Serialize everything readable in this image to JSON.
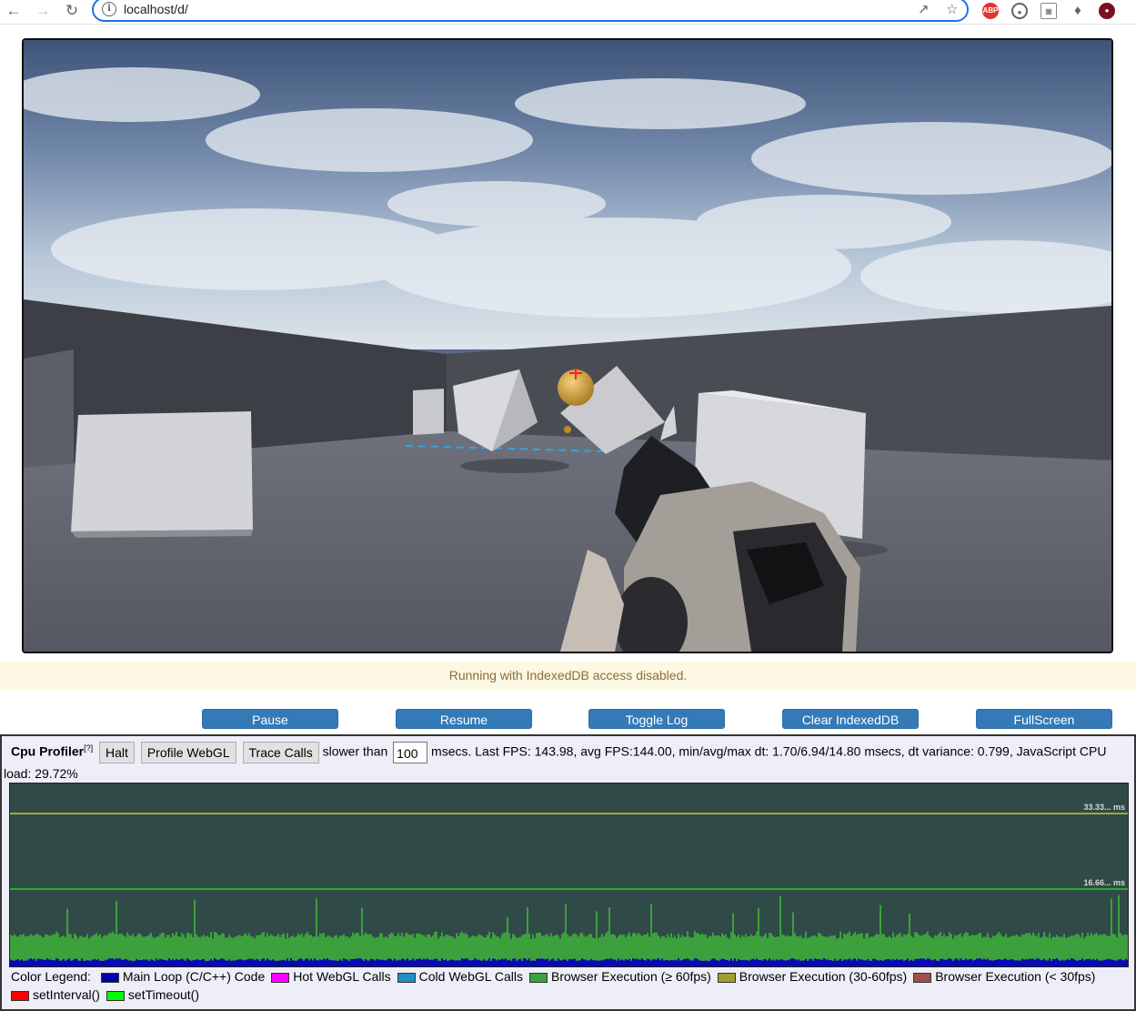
{
  "browser": {
    "url": "localhost/d/",
    "extensions": [
      "abp-icon",
      "vpn-icon",
      "cast-icon",
      "puzzle-extensions-icon",
      "profile-avatar"
    ]
  },
  "game": {
    "scene": "first-person shooter test scene with cubes and gun"
  },
  "status_banner": "Running with IndexedDB access disabled.",
  "controls": {
    "pause": "Pause",
    "resume": "Resume",
    "toggle_log": "Toggle Log",
    "clear_indexeddb": "Clear IndexedDB",
    "fullscreen": "FullScreen"
  },
  "profiler": {
    "title": "Cpu Profiler",
    "help": "[?]",
    "halt": "Halt",
    "profile_webgl": "Profile WebGL",
    "trace_calls": "Trace Calls",
    "slower_than": "slower than",
    "threshold_value": "100",
    "stats": "msecs.  Last FPS: 143.98, avg FPS:144.00, min/avg/max dt: 1.70/6.94/14.80 msecs, dt variance: 0.799, JavaScript CPU",
    "cpu_load": "load: 29.72%",
    "line_30fps_label": "33.33... ms",
    "line_60fps_label": "16.66... ms",
    "legend_title": "Color Legend:",
    "legend": [
      {
        "label": "Main Loop (C/C++) Code",
        "color": "#0000aa"
      },
      {
        "label": "Hot WebGL Calls",
        "color": "#ff00ff"
      },
      {
        "label": "Cold WebGL Calls",
        "color": "#1e90c8"
      },
      {
        "label": "Browser Execution (≥ 60fps)",
        "color": "#3ca03c"
      },
      {
        "label": "Browser Execution (30-60fps)",
        "color": "#a0a032"
      },
      {
        "label": "Browser Execution (< 30fps)",
        "color": "#a05050"
      },
      {
        "label": "setInterval()",
        "color": "#ff0000"
      },
      {
        "label": "setTimeout()",
        "color": "#00ff00"
      }
    ]
  }
}
